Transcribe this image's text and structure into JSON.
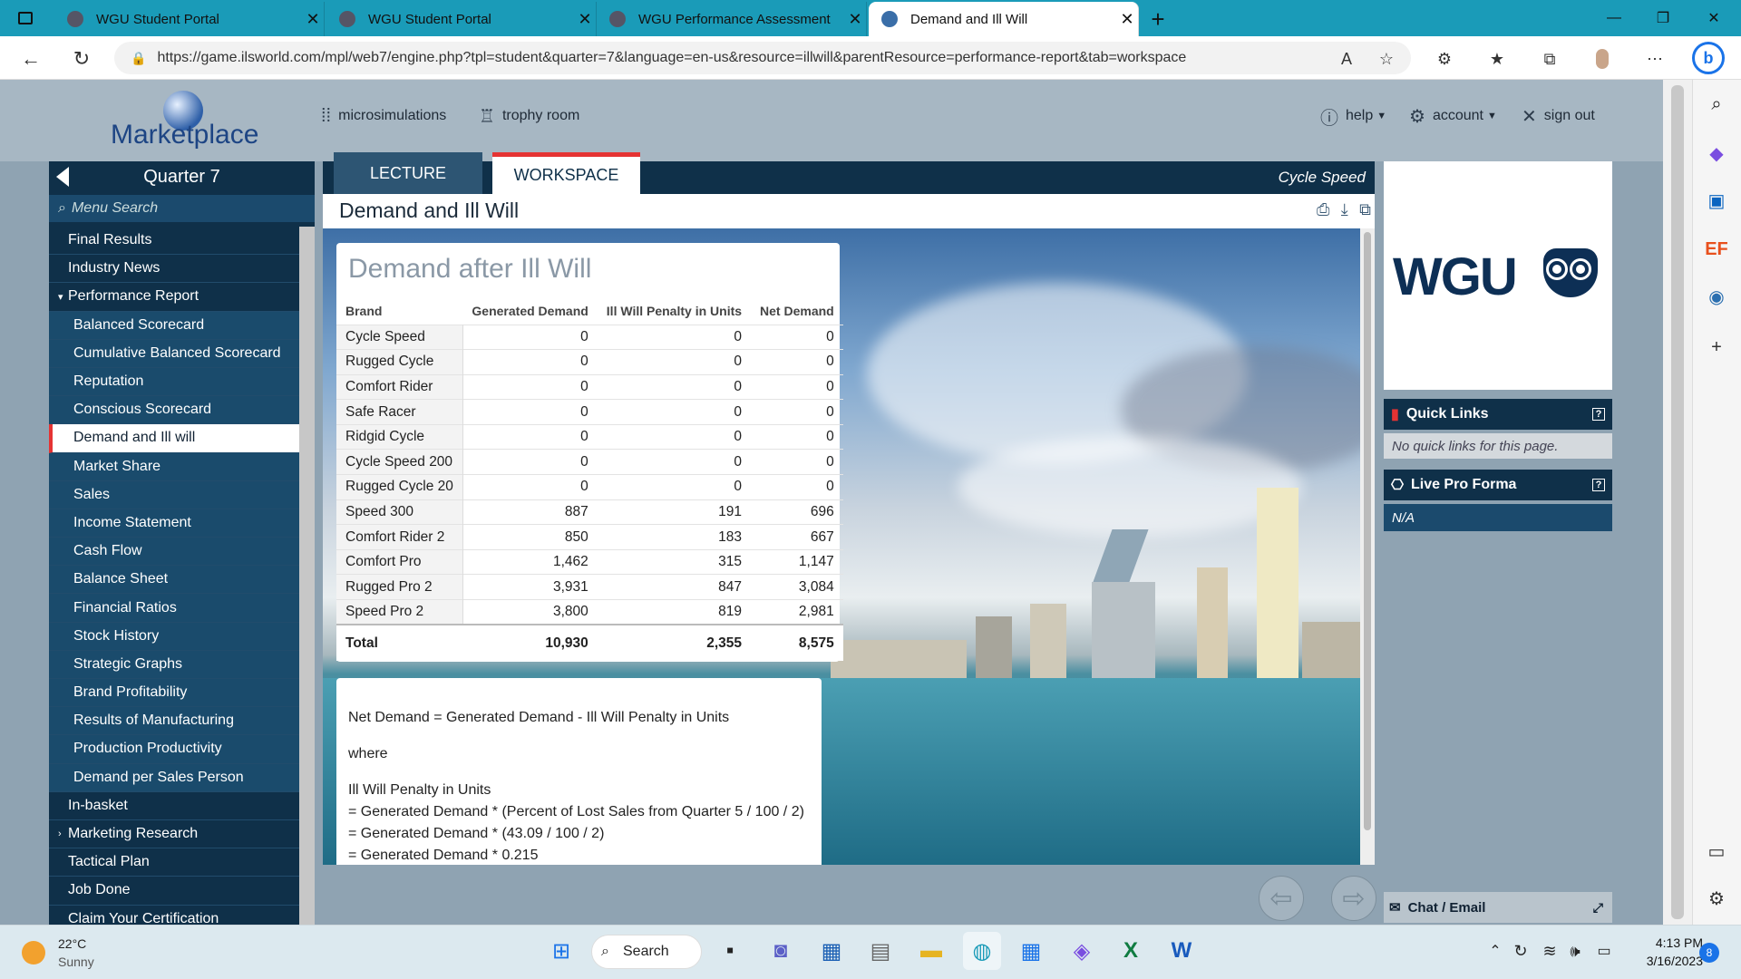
{
  "browser": {
    "tabs": [
      {
        "label": "WGU Student Portal"
      },
      {
        "label": "WGU Student Portal"
      },
      {
        "label": "WGU Performance Assessment"
      },
      {
        "label": "Demand and Ill Will"
      }
    ],
    "url": "https://game.ilsworld.com/mpl/web7/engine.php?tpl=student&quarter=7&language=en-us&resource=illwill&parentResource=performance-report&tab=workspace"
  },
  "header": {
    "logo": "Marketplace",
    "nav": {
      "microsimulations": "microsimulations",
      "trophy": "trophy room",
      "help": "help",
      "account": "account",
      "signout": "sign out"
    }
  },
  "menu": {
    "title": "Quarter 7",
    "search_placeholder": "Menu Search",
    "items": [
      {
        "label": "Final Results",
        "level": 0
      },
      {
        "label": "Industry News",
        "level": 0
      },
      {
        "label": "Performance Report",
        "level": 0,
        "expanded": true
      },
      {
        "label": "Balanced Scorecard",
        "level": 1
      },
      {
        "label": "Cumulative Balanced Scorecard",
        "level": 1
      },
      {
        "label": "Reputation",
        "level": 1
      },
      {
        "label": "Conscious Scorecard",
        "level": 1
      },
      {
        "label": "Demand and Ill will",
        "level": 1,
        "selected": true
      },
      {
        "label": "Market Share",
        "level": 1
      },
      {
        "label": "Sales",
        "level": 1
      },
      {
        "label": "Income Statement",
        "level": 1
      },
      {
        "label": "Cash Flow",
        "level": 1
      },
      {
        "label": "Balance Sheet",
        "level": 1
      },
      {
        "label": "Financial Ratios",
        "level": 1
      },
      {
        "label": "Stock History",
        "level": 1
      },
      {
        "label": "Strategic Graphs",
        "level": 1
      },
      {
        "label": "Brand Profitability",
        "level": 1
      },
      {
        "label": "Results of Manufacturing",
        "level": 1
      },
      {
        "label": "Production Productivity",
        "level": 1
      },
      {
        "label": "Demand per Sales Person",
        "level": 1
      },
      {
        "label": "In-basket",
        "level": 0
      },
      {
        "label": "Marketing Research",
        "level": 0,
        "collapsed": true
      },
      {
        "label": "Tactical Plan",
        "level": 0
      },
      {
        "label": "Job Done",
        "level": 0
      },
      {
        "label": "Claim Your Certification",
        "level": 0
      }
    ]
  },
  "content": {
    "tabs": {
      "lecture": "LECTURE",
      "workspace": "WORKSPACE"
    },
    "company": "Cycle Speed",
    "page_title": "Demand and Ill Will",
    "table": {
      "title": "Demand after Ill Will",
      "columns": [
        "Brand",
        "Generated Demand",
        "Ill Will Penalty in Units",
        "Net Demand"
      ],
      "rows": [
        [
          "Cycle Speed",
          "0",
          "0",
          "0"
        ],
        [
          "Rugged Cycle",
          "0",
          "0",
          "0"
        ],
        [
          "Comfort Rider",
          "0",
          "0",
          "0"
        ],
        [
          "Safe Racer",
          "0",
          "0",
          "0"
        ],
        [
          "Ridgid Cycle",
          "0",
          "0",
          "0"
        ],
        [
          "Cycle Speed 200",
          "0",
          "0",
          "0"
        ],
        [
          "Rugged Cycle 20",
          "0",
          "0",
          "0"
        ],
        [
          "Speed 300",
          "887",
          "191",
          "696"
        ],
        [
          "Comfort Rider 2",
          "850",
          "183",
          "667"
        ],
        [
          "Comfort Pro",
          "1,462",
          "315",
          "1,147"
        ],
        [
          "Rugged Pro 2",
          "3,931",
          "847",
          "3,084"
        ],
        [
          "Speed Pro 2",
          "3,800",
          "819",
          "2,981"
        ]
      ],
      "total": [
        "Total",
        "10,930",
        "2,355",
        "8,575"
      ]
    },
    "formula": {
      "line1": "Net Demand = Generated Demand - Ill Will Penalty in Units",
      "line2": "where",
      "line3": "Ill Will Penalty in Units",
      "line4": "= Generated Demand * (Percent of Lost Sales from Quarter 5 / 100 / 2)",
      "line5": "= Generated Demand * (43.09 / 100 / 2)",
      "line6": "= Generated Demand * 0.215"
    }
  },
  "right": {
    "logo": "WGU",
    "quick_links_title": "Quick Links",
    "quick_links_empty": "No quick links for this page.",
    "pro_forma_title": "Live Pro Forma",
    "pro_forma_value": "N/A",
    "chat": "Chat  / Email"
  },
  "taskbar": {
    "temp": "22°C",
    "weather": "Sunny",
    "search": "Search",
    "time": "4:13 PM",
    "date": "3/16/2023",
    "badge": "8"
  },
  "colors": {
    "accent": "#e53333",
    "navy": "#0f3049",
    "tabbar": "#1a9bb8"
  }
}
